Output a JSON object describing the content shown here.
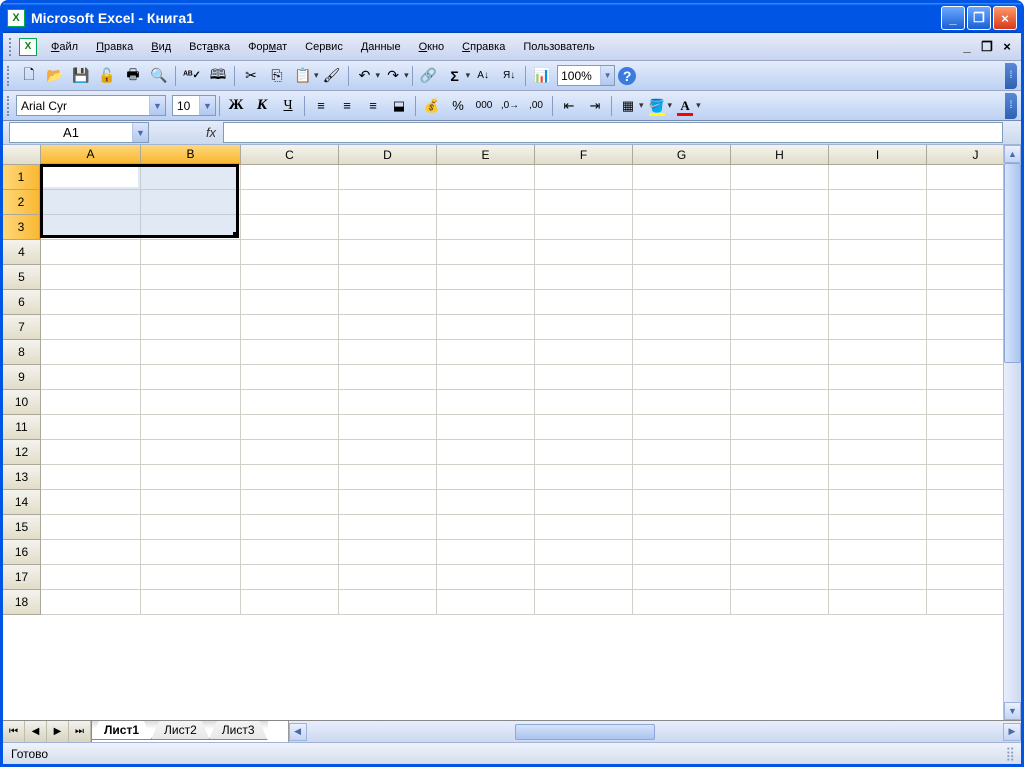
{
  "title": "Microsoft Excel - Книга1",
  "menus": {
    "file": "Файл",
    "edit": "Правка",
    "view": "Вид",
    "insert": "Вставка",
    "format": "Формат",
    "tools": "Сервис",
    "data": "Данные",
    "window": "Окно",
    "help": "Справка",
    "user": "Пользователь"
  },
  "format_bar": {
    "font": "Arial Cyr",
    "size": "10",
    "bold": "Ж",
    "italic": "К",
    "underline": "Ч",
    "percent": "%",
    "thousands": "000"
  },
  "zoom": "100%",
  "name_box": "A1",
  "fx_label": "fx",
  "columns": [
    "A",
    "B",
    "C",
    "D",
    "E",
    "F",
    "G",
    "H",
    "I",
    "J"
  ],
  "col_width_first_two": 100,
  "col_width_rest": 98,
  "rows": [
    1,
    2,
    3,
    4,
    5,
    6,
    7,
    8,
    9,
    10,
    11,
    12,
    13,
    14,
    15,
    16,
    17,
    18
  ],
  "selected_cols": [
    "A",
    "B"
  ],
  "selected_rows": [
    1,
    2,
    3
  ],
  "active_cell": "A1",
  "sheet_tabs": [
    "Лист1",
    "Лист2",
    "Лист3"
  ],
  "active_tab": 0,
  "status": "Готово"
}
